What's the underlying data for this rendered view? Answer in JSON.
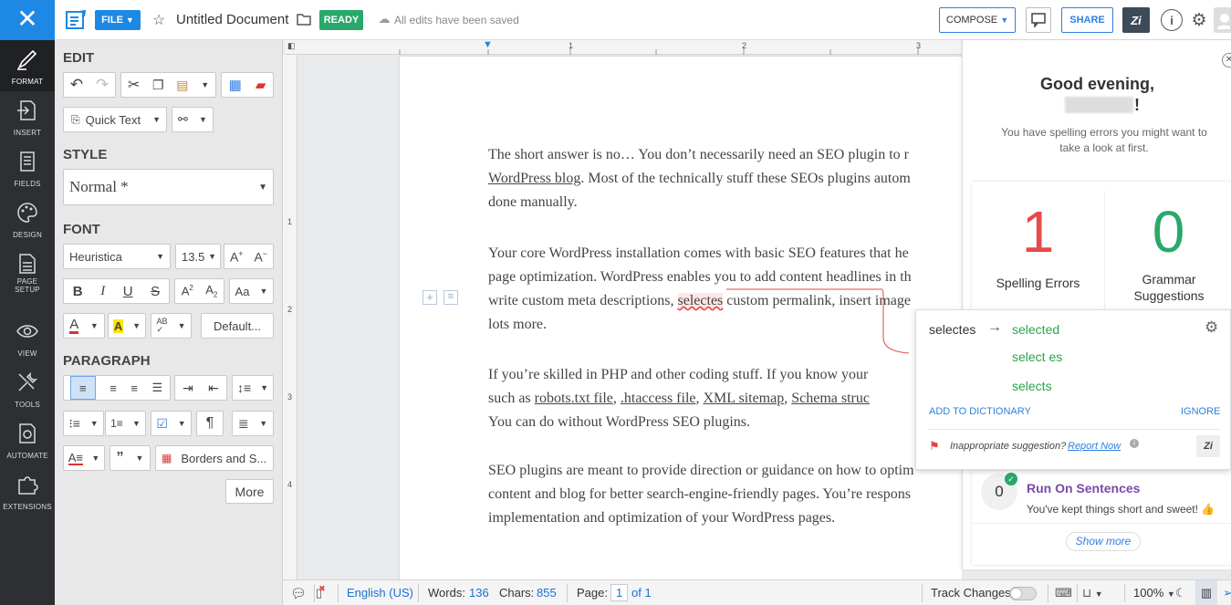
{
  "topbar": {
    "file_label": "FILE",
    "doc_title": "Untitled Document",
    "status_badge": "READY",
    "saved_text": "All edits have been saved",
    "compose_label": "COMPOSE",
    "share_label": "SHARE"
  },
  "rail": {
    "items": [
      {
        "label": "FORMAT",
        "icon": "format-brush-icon"
      },
      {
        "label": "INSERT",
        "icon": "insert-icon"
      },
      {
        "label": "FIELDS",
        "icon": "fields-icon"
      },
      {
        "label": "DESIGN",
        "icon": "palette-icon"
      },
      {
        "label": "PAGE SETUP",
        "icon": "page-setup-icon"
      },
      {
        "label": "VIEW",
        "icon": "eye-icon"
      },
      {
        "label": "TOOLS",
        "icon": "tools-icon"
      },
      {
        "label": "AUTOMATE",
        "icon": "automate-icon"
      },
      {
        "label": "EXTENSIONS",
        "icon": "puzzle-icon"
      }
    ]
  },
  "panel": {
    "edit_heading": "EDIT",
    "quick_text": "Quick Text",
    "style_heading": "STYLE",
    "style_value": "Normal *",
    "font_heading": "FONT",
    "font_name": "Heuristica",
    "font_size": "13.5",
    "default_label": "Default...",
    "paragraph_heading": "PARAGRAPH",
    "borders_label": "Borders and S...",
    "more_label": "More"
  },
  "document": {
    "p1": [
      "The short answer is no… You don’t necessarily need an SEO plugin to r",
      "WordPress blog",
      ". Most of the technically stuff these SEOs plugins autom",
      "done manually."
    ],
    "p2": [
      "Your core WordPress installation comes with basic SEO features that he",
      "page optimization. WordPress enables you to add content headlines in th",
      "write custom meta descriptions, ",
      "selectes",
      " custom permalink, insert image",
      "lots more."
    ],
    "p3": [
      "If you’re skilled in PHP and other coding stuff. If you know your",
      "such as ",
      "robots.txt file",
      ", ",
      ".htaccess file",
      ", ",
      "XML sitemap",
      ", ",
      "Schema struc",
      "You can do without WordPress SEO plugins."
    ],
    "p4": [
      "SEO plugins are meant to provide direction or guidance on how to optim",
      "content and blog for better search-engine-friendly pages. You’re respons",
      "implementation and optimization of your WordPress pages."
    ]
  },
  "status": {
    "language": "English (US)",
    "words_label": "Words:",
    "words_value": "136",
    "chars_label": "Chars:",
    "chars_value": "855",
    "page_label": "Page:",
    "page_value": "1",
    "page_total": "of 1",
    "track_changes": "Track Changes",
    "zoom": "100%"
  },
  "zia": {
    "greeting": "Good evening,",
    "greeting_end": "!",
    "subtitle": "You have spelling errors you might want to take a look at first.",
    "spelling_count": "1",
    "spelling_label": "Spelling Errors",
    "grammar_count": "0",
    "grammar_label": "Grammar Suggestions",
    "run_on_count": "0",
    "run_on_title": "Run On Sentences",
    "run_on_desc": "You've kept things short and sweet! 👍",
    "show_more": "Show more"
  },
  "popup": {
    "word": "selectes",
    "suggestions": [
      "selected",
      "select es",
      "selects"
    ],
    "add_to_dictionary": "ADD TO DICTIONARY",
    "ignore": "IGNORE",
    "inappropriate": "Inappropriate suggestion?",
    "report": "Report Now"
  },
  "colors": {
    "accent": "#1e88e5",
    "ready": "#2aa86b",
    "spelling": "#e64a4a",
    "grammar": "#2aa86b",
    "rail": "#2d2f33"
  }
}
